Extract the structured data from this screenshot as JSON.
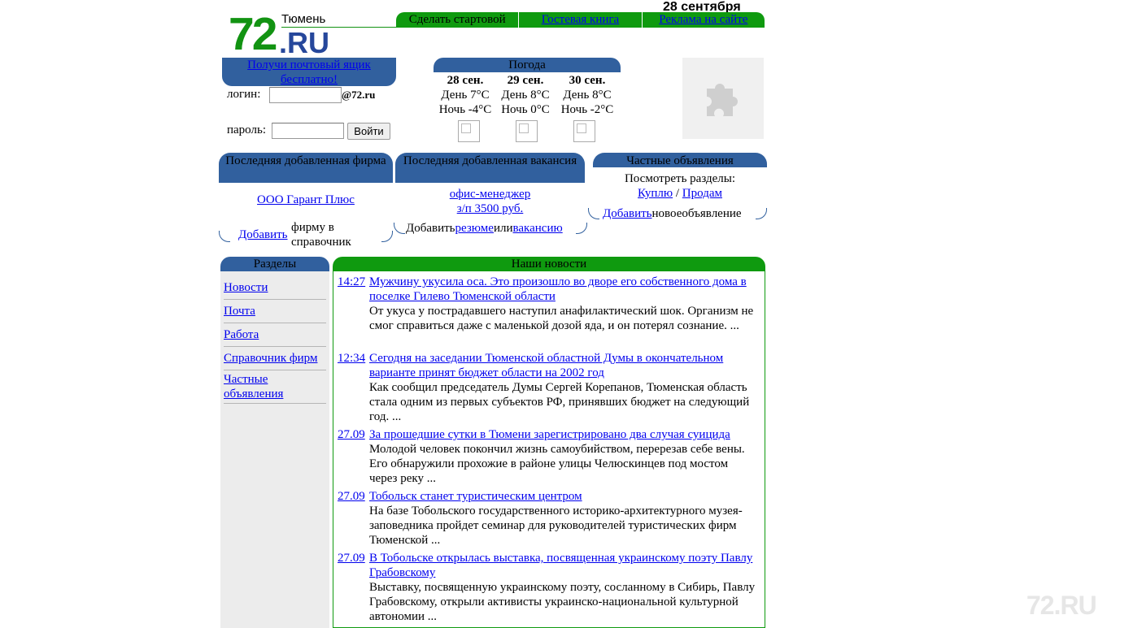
{
  "header": {
    "logo_number": "72",
    "logo_domain": ".RU",
    "city": "Тюмень",
    "date": "28 сентября",
    "nav": [
      {
        "label": "Сделать стартовой",
        "link": false
      },
      {
        "label": "Гостевая книга",
        "link": true
      },
      {
        "label": "Реклама на сайте",
        "link": true
      }
    ]
  },
  "mail": {
    "title_line1": "Получи почтовый ящик",
    "title_line2": "бесплатно!",
    "login_label": "логин:",
    "domain": "@72.ru",
    "password_label": "пароль:",
    "submit_label": "Войти"
  },
  "weather": {
    "title": "Погода",
    "days": [
      {
        "date": "28 сен.",
        "day": "День 7°C",
        "night": "Ночь -4°C"
      },
      {
        "date": "29 сен.",
        "day": "День 8°C",
        "night": "Ночь 0°C"
      },
      {
        "date": "30 сен.",
        "day": "День 8°C",
        "night": "Ночь -2°C"
      }
    ]
  },
  "plugin": {
    "icon": "puzzle-icon"
  },
  "firm_box": {
    "title": "Последняя добавленная фирма",
    "firm": "ООО Гарант Плюс",
    "add_link": "Добавить",
    "add_text": "фирму в справочник"
  },
  "vacancy_box": {
    "title": "Последняя добавленная вакансия",
    "vacancy": "офис-менеджер",
    "salary": "з/п 3500 руб.",
    "add_prefix": "Добавить",
    "resume_link": "резюме",
    "or_text": "или",
    "vacancy_link": "вакансию"
  },
  "ads_box": {
    "title": "Частные объявления",
    "browse_text": "Посмотреть разделы:",
    "buy_link": "Куплю",
    "separator": "/",
    "sell_link": "Продам",
    "add_link": "Добавить",
    "add_text1": "новое",
    "add_text2": "объявление"
  },
  "sections": {
    "title": "Разделы",
    "items": [
      {
        "label": "Новости"
      },
      {
        "label": "Почта"
      },
      {
        "label": "Работа"
      },
      {
        "label": "Справочник фирм"
      },
      {
        "label": "Частные объявления"
      }
    ]
  },
  "news": {
    "title": "Наши новости",
    "items": [
      {
        "time": "14:27",
        "headline": "Мужчину укусила оса. Это произошло во дворе его собственного дома в поселке Гилево Тюменской области",
        "summary": "От укуса у пострадавшего наступил анафилактический шок. Организм не смог справиться даже с маленькой дозой яда, и он потерял сознание. ..."
      },
      {
        "time": "12:34",
        "headline": "Сегодня на заседании Тюменской областной Думы в окончательном варианте принят бюджет области на 2002 год",
        "summary": "Как сообщил председатель Думы Сергей Корепанов, Тюменская область стала одним из первых субъектов РФ, принявших бюджет на следующий год. ..."
      },
      {
        "time": "27.09",
        "headline": "За прошедшие сутки в Тюмени зарегистрировано два случая суицида",
        "summary": "Молодой человек покончил жизнь самоубийством, перерезав себе вены. Его обнаружили прохожие в районе улицы Челюскинцев под мостом через реку ..."
      },
      {
        "time": "27.09",
        "headline": "Тобольск станет туристическим центром",
        "summary": "На базе Тобольского государственного историко-архитектурного музея-заповедника пройдет семинар для руководителей туристических фирм Тюменской ..."
      },
      {
        "time": "27.09",
        "headline": "В Тобольске открылась выставка, посвященная украинскому поэту Павлу Грабовскому",
        "summary": "Выставку, посвященную украинскому поэту, сосланному в Сибирь, Павлу Грабовскому, открыли активисты украинско-национальной культурной автономии ..."
      }
    ]
  },
  "watermark": {
    "text": "72.RU"
  }
}
